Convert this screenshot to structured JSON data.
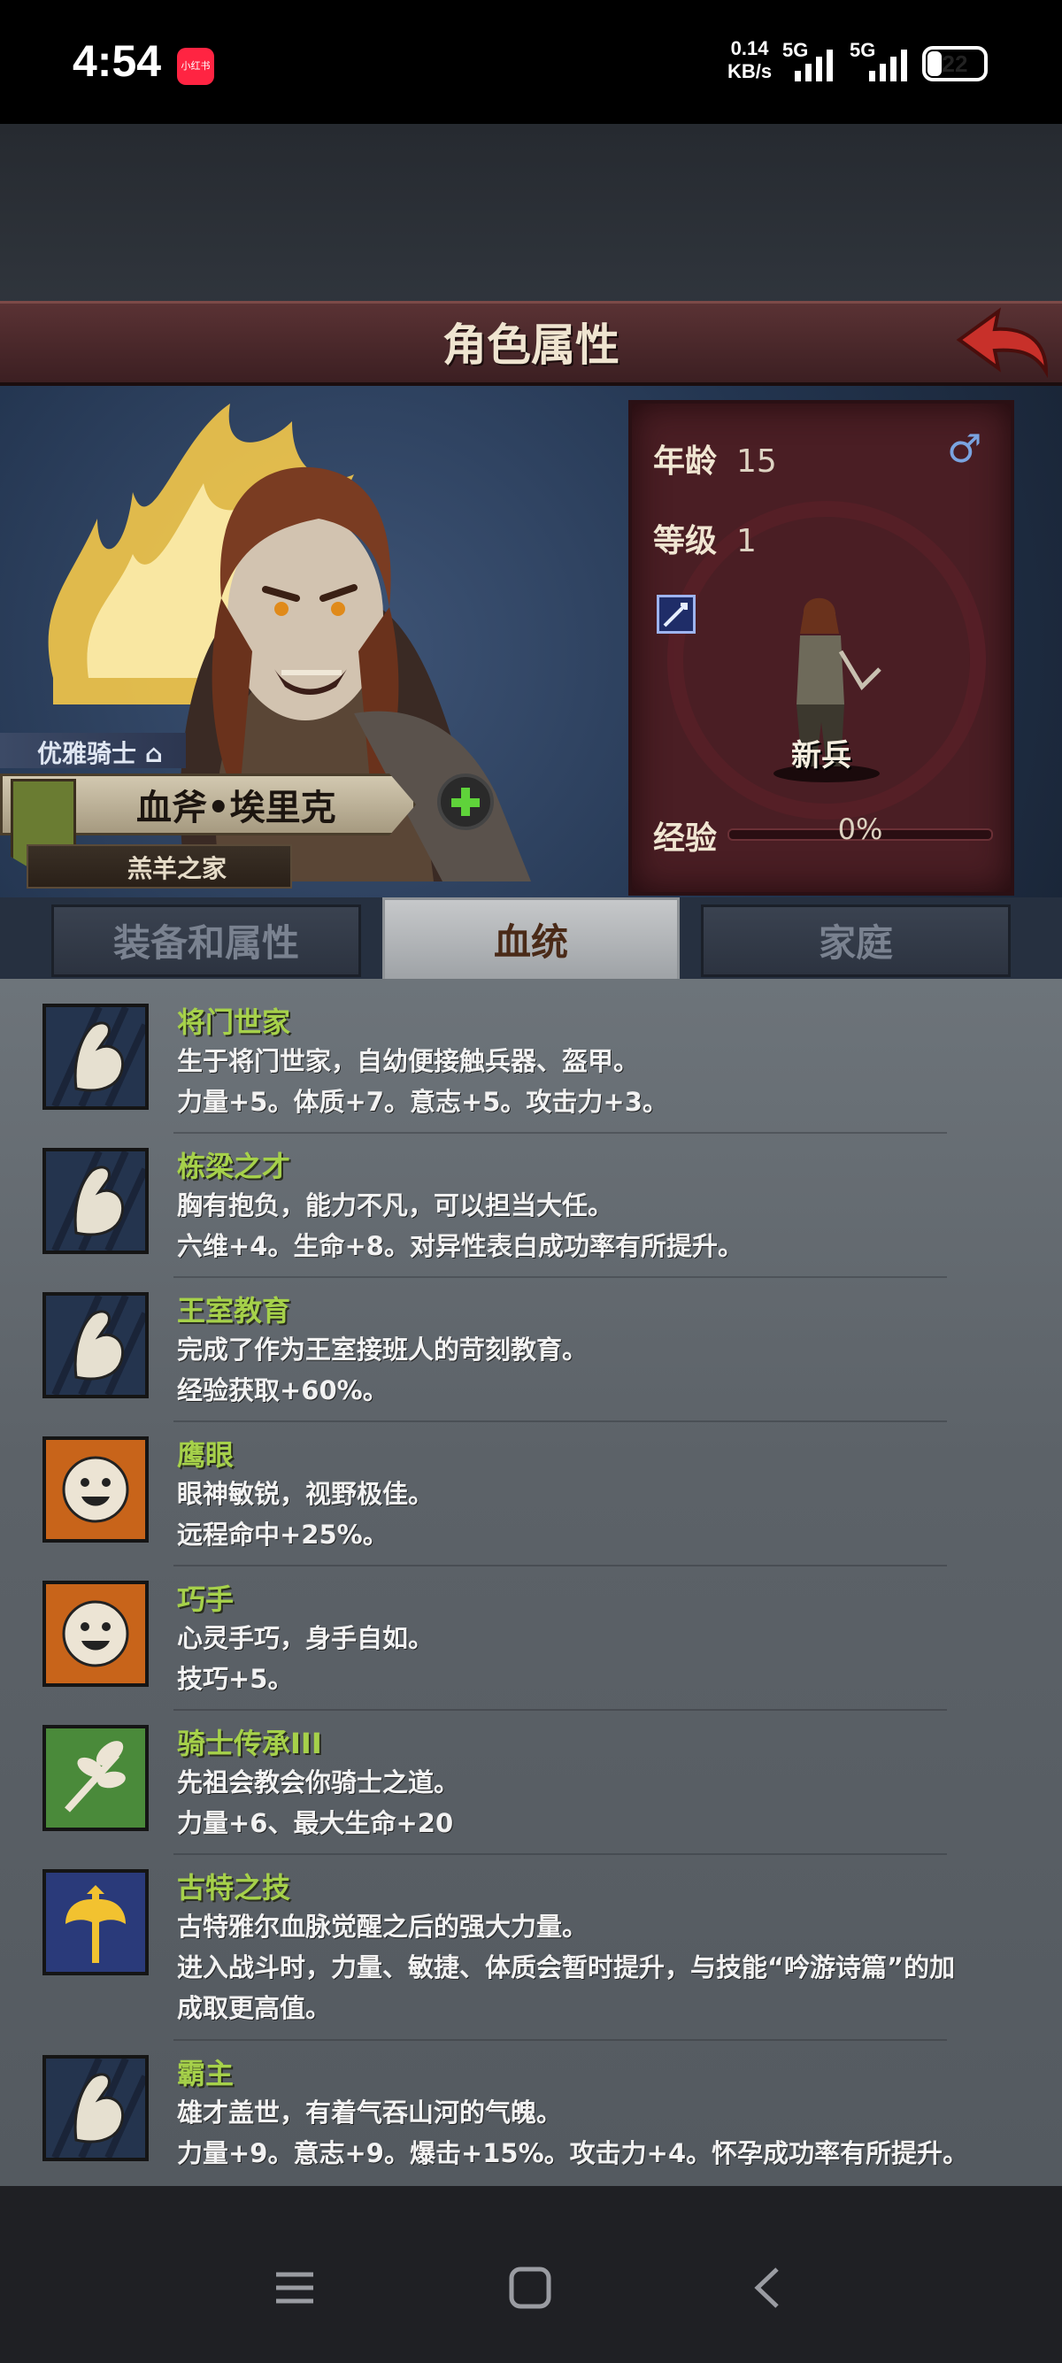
{
  "status": {
    "time": "4:54",
    "app_badge": "小红书",
    "speed_value": "0.14",
    "speed_unit": "KB/s",
    "net1": "5G",
    "net2": "5G",
    "battery": "22"
  },
  "header": {
    "title": "角色属性",
    "back_icon": "back-arrow-icon"
  },
  "character": {
    "class_name": "优雅骑士",
    "name": "血斧•埃里克",
    "house": "羔羊之家",
    "age_label": "年龄",
    "age": "15",
    "gender_symbol": "♂",
    "level_label": "等级",
    "level": "1",
    "rank": "新兵",
    "exp_label": "经验",
    "exp_value": "0%",
    "exp_fraction": 0
  },
  "tabs": [
    {
      "label": "装备和属性",
      "active": false
    },
    {
      "label": "血统",
      "active": true
    },
    {
      "label": "家庭",
      "active": false
    }
  ],
  "traits": [
    {
      "icon": "muscle-arm-icon",
      "name": "将门世家",
      "lines": [
        "生于将门世家，自幼便接触兵器、盔甲。",
        "力量+5。体质+7。意志+5。攻击力+3。"
      ]
    },
    {
      "icon": "muscle-arm-icon",
      "name": "栋梁之才",
      "lines": [
        "胸有抱负，能力不凡，可以担当大任。",
        "六维+4。生命+8。对异性表白成功率有所提升。"
      ]
    },
    {
      "icon": "muscle-arm-icon",
      "name": "王室教育",
      "lines": [
        "完成了作为王室接班人的苛刻教育。",
        "经验获取+60%。"
      ]
    },
    {
      "icon": "smiley-face-icon",
      "name": "鹰眼",
      "lines": [
        "眼神敏锐，视野极佳。",
        "远程命中+25%。"
      ]
    },
    {
      "icon": "smiley-face-icon",
      "name": "巧手",
      "lines": [
        "心灵手巧，身手自如。",
        "技巧+5。"
      ]
    },
    {
      "icon": "leaf-branch-icon",
      "name": "骑士传承III",
      "lines": [
        "先祖会教会你骑士之道。",
        "力量+6、最大生命+20"
      ]
    },
    {
      "icon": "golden-axe-icon",
      "name": "古特之技",
      "lines": [
        "古特雅尔血脉觉醒之后的强大力量。",
        "进入战斗时，力量、敏捷、体质会暂时提升，与技能“吟游诗篇”的加",
        "成取更高值。"
      ]
    },
    {
      "icon": "muscle-arm-icon",
      "name": "霸主",
      "lines": [
        "雄才盖世，有着气吞山河的气魄。",
        "力量+9。意志+9。爆击+15%。攻击力+4。怀孕成功率有所提升。"
      ]
    }
  ],
  "colors": {
    "trait_name": "#a6d14a",
    "panel": "#4a1e24",
    "accent_green": "#5fd33a"
  }
}
